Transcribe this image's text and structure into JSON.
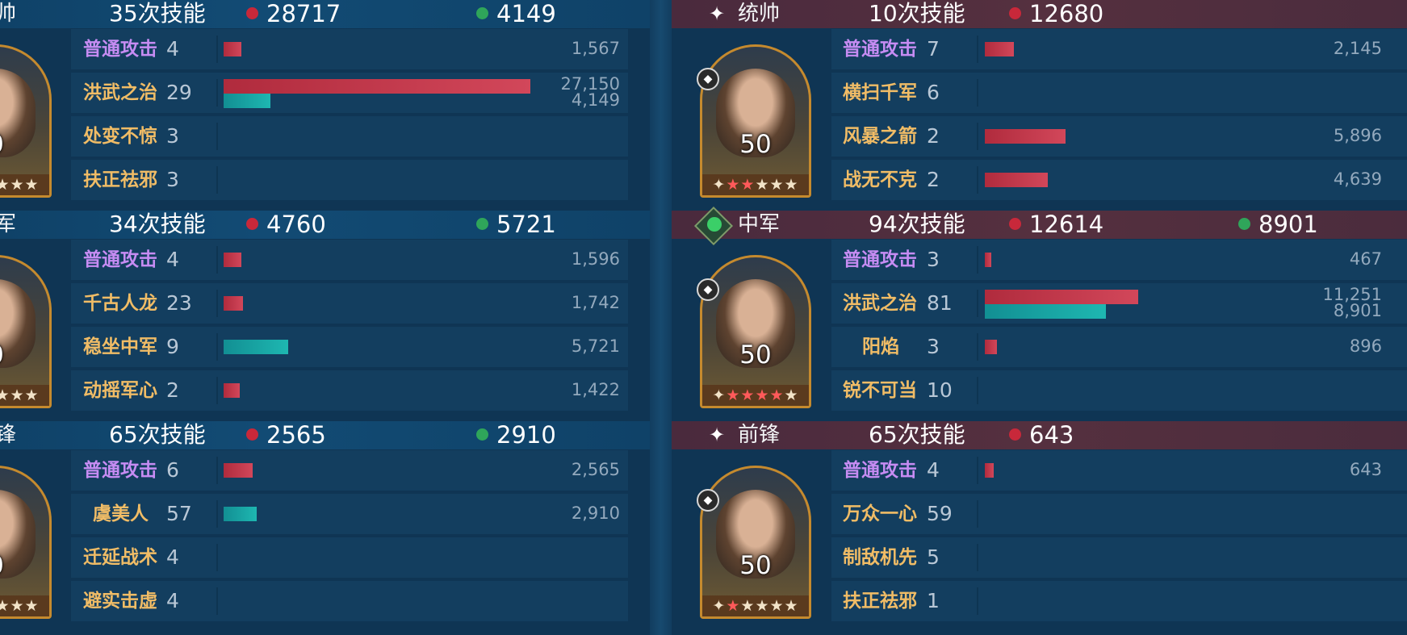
{
  "left": {
    "sections": [
      {
        "role": "帅",
        "count": "35次技能",
        "damage": "28717",
        "heal": "4149",
        "level": "0",
        "stars_red": 0,
        "rows": [
          {
            "skill": "普通攻击",
            "n": "4",
            "red": 1567,
            "teal": 0,
            "v1": "1,567",
            "v2": ""
          },
          {
            "skill": "洪武之治",
            "n": "29",
            "red": 27150,
            "teal": 4149,
            "v1": "27,150",
            "v2": "4,149"
          },
          {
            "skill": "处变不惊",
            "n": "3",
            "red": 0,
            "teal": 0,
            "v1": "",
            "v2": ""
          },
          {
            "skill": "扶正祛邪",
            "n": "3",
            "red": 0,
            "teal": 0,
            "v1": "",
            "v2": ""
          }
        ]
      },
      {
        "role": "军",
        "count": "34次技能",
        "damage": "4760",
        "heal": "5721",
        "level": "0",
        "rows": [
          {
            "skill": "普通攻击",
            "n": "4",
            "red": 1596,
            "teal": 0,
            "v1": "1,596",
            "v2": ""
          },
          {
            "skill": "千古人龙",
            "n": "23",
            "red": 1742,
            "teal": 0,
            "v1": "1,742",
            "v2": ""
          },
          {
            "skill": "稳坐中军",
            "n": "9",
            "red": 0,
            "teal": 5721,
            "v1": "5,721",
            "v2": ""
          },
          {
            "skill": "动摇军心",
            "n": "2",
            "red": 1422,
            "teal": 0,
            "v1": "1,422",
            "v2": ""
          }
        ]
      },
      {
        "role": "锋",
        "count": "65次技能",
        "damage": "2565",
        "heal": "2910",
        "level": "0",
        "rows": [
          {
            "skill": "普通攻击",
            "n": "6",
            "red": 2565,
            "teal": 0,
            "v1": "2,565",
            "v2": ""
          },
          {
            "skill": "虞美人",
            "n": "57",
            "red": 0,
            "teal": 2910,
            "v1": "2,910",
            "v2": ""
          },
          {
            "skill": "迁延战术",
            "n": "4",
            "red": 0,
            "teal": 0,
            "v1": "",
            "v2": ""
          },
          {
            "skill": "避实击虚",
            "n": "4",
            "red": 0,
            "teal": 0,
            "v1": "",
            "v2": ""
          }
        ]
      }
    ]
  },
  "right": {
    "sections": [
      {
        "role": "统帅",
        "count": "10次技能",
        "damage": "12680",
        "heal": "",
        "level": "50",
        "stars_red": 2,
        "rows": [
          {
            "skill": "普通攻击",
            "n": "7",
            "red": 2145,
            "teal": 0,
            "v1": "2,145",
            "v2": ""
          },
          {
            "skill": "横扫千军",
            "n": "6",
            "red": 0,
            "teal": 0,
            "v1": "",
            "v2": ""
          },
          {
            "skill": "风暴之箭",
            "n": "2",
            "red": 5896,
            "teal": 0,
            "v1": "5,896",
            "v2": ""
          },
          {
            "skill": "战无不克",
            "n": "2",
            "red": 4639,
            "teal": 0,
            "v1": "4,639",
            "v2": ""
          }
        ]
      },
      {
        "role": "中军",
        "count": "94次技能",
        "damage": "12614",
        "heal": "8901",
        "level": "50",
        "stars_red": 4,
        "rows": [
          {
            "skill": "普通攻击",
            "n": "3",
            "red": 467,
            "teal": 0,
            "v1": "467",
            "v2": ""
          },
          {
            "skill": "洪武之治",
            "n": "81",
            "red": 11251,
            "teal": 8901,
            "v1": "11,251",
            "v2": "8,901"
          },
          {
            "skill": "阳焰",
            "n": "3",
            "red": 896,
            "teal": 0,
            "v1": "896",
            "v2": ""
          },
          {
            "skill": "锐不可当",
            "n": "10",
            "red": 0,
            "teal": 0,
            "v1": "",
            "v2": ""
          }
        ]
      },
      {
        "role": "前锋",
        "count": "65次技能",
        "damage": "643",
        "heal": "",
        "level": "50",
        "stars_red": 1,
        "rows": [
          {
            "skill": "普通攻击",
            "n": "4",
            "red": 643,
            "teal": 0,
            "v1": "643",
            "v2": ""
          },
          {
            "skill": "万众一心",
            "n": "59",
            "red": 0,
            "teal": 0,
            "v1": "",
            "v2": ""
          },
          {
            "skill": "制敌机先",
            "n": "5",
            "red": 0,
            "teal": 0,
            "v1": "",
            "v2": ""
          },
          {
            "skill": "扶正祛邪",
            "n": "1",
            "red": 0,
            "teal": 0,
            "v1": "",
            "v2": ""
          }
        ]
      }
    ]
  },
  "colors": {
    "damage": "#c8283a",
    "heal": "#2fa55a",
    "basic_skill": "#c68cf3",
    "skill": "#f0bc66"
  },
  "icons": {
    "role_star": "✦",
    "troop_badge": "tank-icon"
  }
}
